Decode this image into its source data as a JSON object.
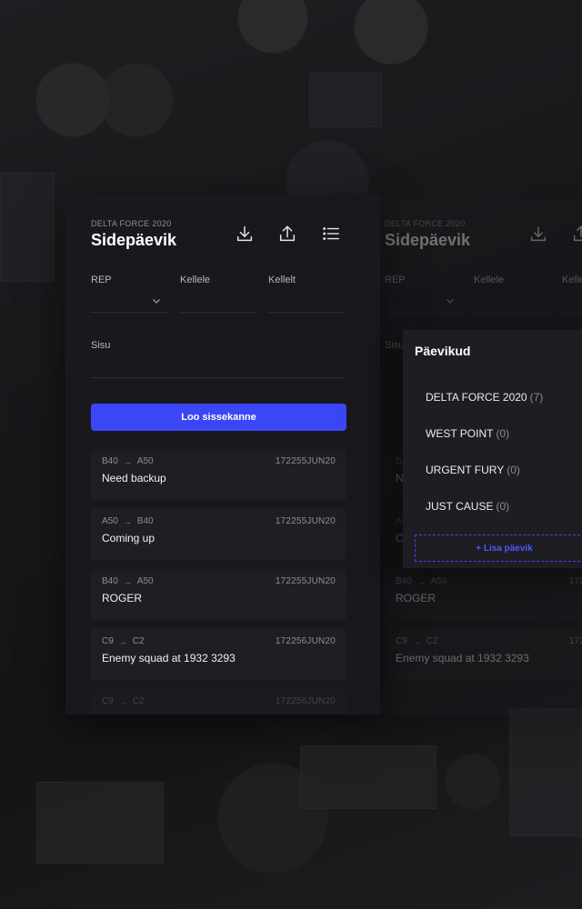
{
  "app": {
    "subtitle": "DELTA FORCE 2020",
    "title": "Sidepäevik"
  },
  "toolbar": {
    "icons": [
      "download-icon",
      "upload-icon",
      "list-icon"
    ]
  },
  "form": {
    "rep_label": "REP",
    "to_label": "Kellele",
    "from_label": "Kellelt",
    "content_label": "Sisu",
    "submit_label": "Loo sissekanne"
  },
  "entries": [
    {
      "from": "B40",
      "arrow": "→",
      "to": "A50",
      "time": "172255JUN20",
      "message": "Need backup"
    },
    {
      "from": "A50",
      "arrow": "→",
      "to": "B40",
      "time": "172255JUN20",
      "message": "Coming up"
    },
    {
      "from": "B40",
      "arrow": "→",
      "to": "A50",
      "time": "172255JUN20",
      "message": "ROGER"
    },
    {
      "from": "C9",
      "arrow": "→",
      "to": "C2",
      "time": "172256JUN20",
      "message": "Enemy squad at 1932 3293"
    },
    {
      "from": "C9",
      "arrow": "→",
      "to": "C2",
      "time": "172256JUN20",
      "message": ""
    }
  ],
  "journals": {
    "title": "Päevikud",
    "items": [
      {
        "name": "DELTA FORCE 2020",
        "count": "(7)"
      },
      {
        "name": "WEST POINT",
        "count": "(0)"
      },
      {
        "name": "URGENT FURY",
        "count": "(0)"
      },
      {
        "name": "JUST CAUSE",
        "count": "(0)"
      }
    ],
    "add_label": "+ Lisa päevik"
  },
  "colors": {
    "accent": "#3b46f6",
    "panel": "#19191d",
    "text": "#ffffff"
  }
}
